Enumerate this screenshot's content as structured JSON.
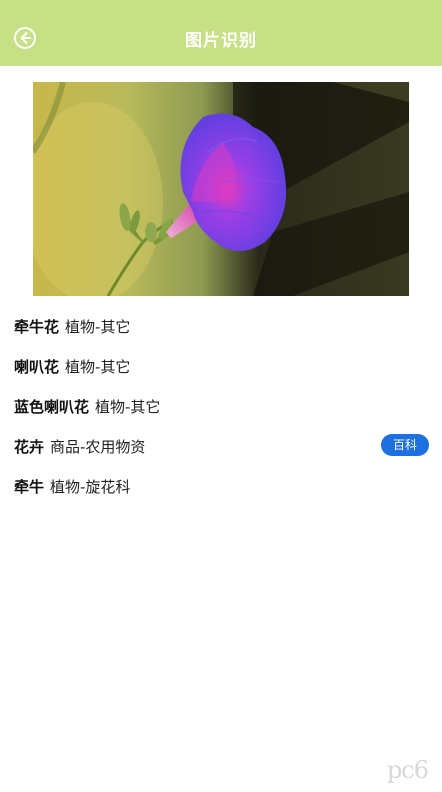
{
  "header": {
    "title": "图片识别",
    "back_icon": "back-arrow-circle-icon",
    "background_color": "#c7df85"
  },
  "photo": {
    "subject": "morning-glory-flower-photo"
  },
  "results": [
    {
      "name": "牵牛花",
      "category": "植物-其它"
    },
    {
      "name": "喇叭花",
      "category": "植物-其它"
    },
    {
      "name": "蓝色喇叭花",
      "category": "植物-其它"
    },
    {
      "name": "花卉",
      "category": "商品-农用物资",
      "action_label": "百科"
    },
    {
      "name": "牵牛",
      "category": "植物-旋花科"
    }
  ],
  "accent_color": "#1e6fe0",
  "watermark": "pc6"
}
